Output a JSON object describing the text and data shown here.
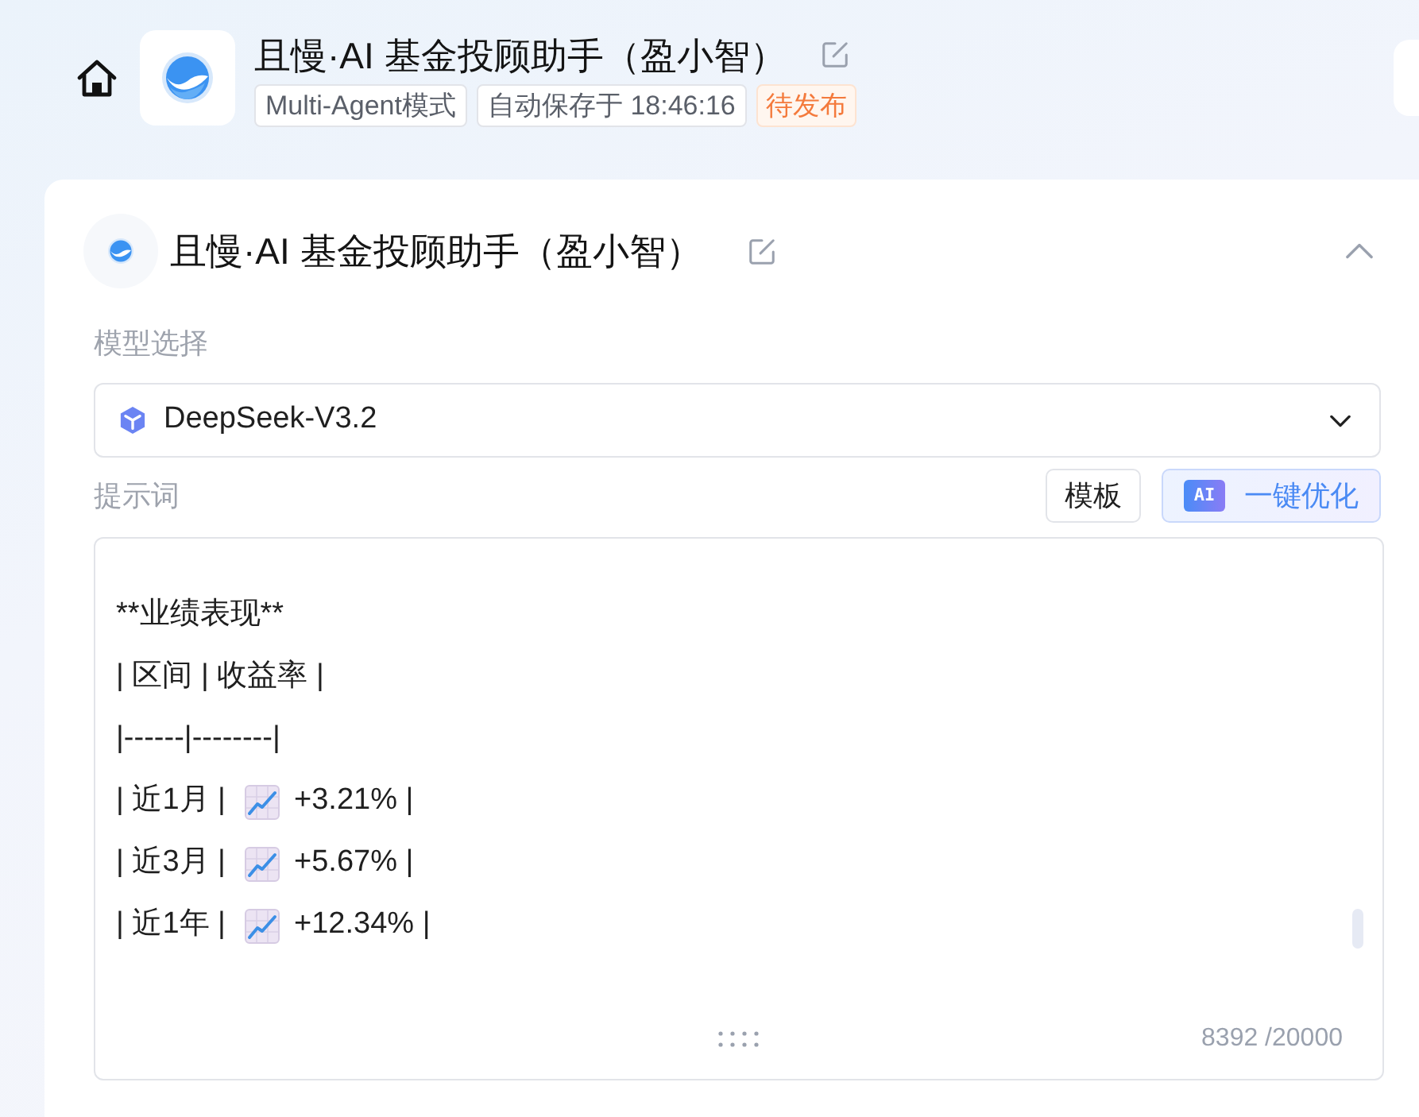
{
  "header": {
    "title": "且慢·AI 基金投顾助手（盈小智）",
    "tags": [
      {
        "label": "Multi-Agent模式",
        "kind": "info"
      },
      {
        "label": "自动保存于 18:46:16",
        "kind": "info"
      },
      {
        "label": "待发布",
        "kind": "status"
      }
    ]
  },
  "agent": {
    "name": "且慢·AI 基金投顾助手（盈小智）",
    "expanded": true,
    "model": {
      "label": "模型选择",
      "value": "DeepSeek-V3.2"
    },
    "prompt": {
      "label": "提示词",
      "buttons": [
        {
          "label": "模板",
          "kind": "plain"
        },
        {
          "label": "一键优化",
          "kind": "ai",
          "badge": "AI"
        }
      ],
      "lines": [
        {
          "kind": "text",
          "text": "**业绩表现**"
        },
        {
          "kind": "text",
          "text": "| 区间 | 收益率 |"
        },
        {
          "kind": "text",
          "text": "|------|--------|"
        },
        {
          "kind": "trend",
          "before": "| 近1月 |",
          "after": "+3.21% |"
        },
        {
          "kind": "trend",
          "before": "| 近3月 |",
          "after": "+5.67% |"
        },
        {
          "kind": "trend",
          "before": "| 近1年 |",
          "after": "+12.34% |"
        }
      ],
      "char_count": "8392 /20000"
    }
  }
}
